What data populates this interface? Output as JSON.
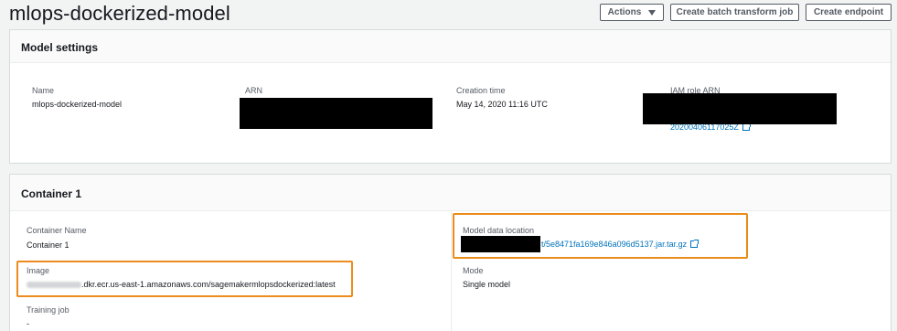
{
  "header": {
    "title": "mlops-dockerized-model",
    "actions_label": "Actions",
    "create_batch_label": "Create batch transform job",
    "create_endpoint_label": "Create endpoint"
  },
  "model_settings": {
    "title": "Model settings",
    "name_label": "Name",
    "name_value": "mlops-dockerized-model",
    "arn_label": "ARN",
    "creation_time_label": "Creation time",
    "creation_time_value": "May 14, 2020 11:16 UTC",
    "iam_role_label": "IAM role ARN",
    "iam_role_link_suffix": "20200406117025Z"
  },
  "container": {
    "title": "Container 1",
    "container_name_label": "Container Name",
    "container_name_value": "Container 1",
    "image_label": "Image",
    "image_value_suffix": ".dkr.ecr.us-east-1.amazonaws.com/sagemakermlopsdockerized:latest",
    "training_job_label": "Training job",
    "training_job_value": "-",
    "model_data_label": "Model data location",
    "model_data_link_suffix": "t/5e8471fa169e846a096d5137.jar.tar.gz",
    "mode_label": "Mode",
    "mode_value": "Single model"
  },
  "colors": {
    "highlight": "#ec8c1d",
    "link": "#0073bb"
  }
}
